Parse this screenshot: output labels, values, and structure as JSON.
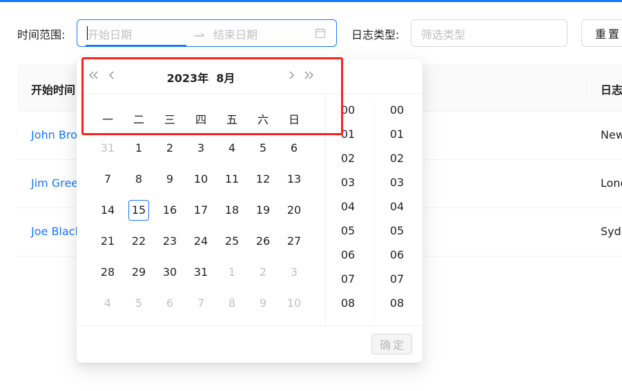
{
  "colors": {
    "primary": "#1677ff",
    "highlight": "#ff1f1f"
  },
  "filters": {
    "time_range_label": "时间范围:",
    "start_placeholder": "开始日期",
    "separator": "→",
    "end_placeholder": "结束日期",
    "log_type_label": "日志类型:",
    "log_type_placeholder": "筛选类型",
    "reset_label": "重置"
  },
  "table": {
    "columns": [
      "开始时间",
      "日志"
    ],
    "rows": [
      {
        "name": "John Bro",
        "city": "New"
      },
      {
        "name": "Jim Gree",
        "city": "Lond"
      },
      {
        "name": "Joe Black",
        "city": "Sydn"
      }
    ]
  },
  "picker": {
    "title": "2023年  8月",
    "prev_year_icon": "double-left-icon",
    "prev_month_icon": "left-icon",
    "next_month_icon": "right-icon",
    "next_year_icon": "double-right-icon",
    "weekdays": [
      "一",
      "二",
      "三",
      "四",
      "五",
      "六",
      "日"
    ],
    "weeks": [
      [
        "31",
        "1",
        "2",
        "3",
        "4",
        "5",
        "6"
      ],
      [
        "7",
        "8",
        "9",
        "10",
        "11",
        "12",
        "13"
      ],
      [
        "14",
        "15",
        "16",
        "17",
        "18",
        "19",
        "20"
      ],
      [
        "21",
        "22",
        "23",
        "24",
        "25",
        "26",
        "27"
      ],
      [
        "28",
        "29",
        "30",
        "31",
        "1",
        "2",
        "3"
      ],
      [
        "4",
        "5",
        "6",
        "7",
        "8",
        "9",
        "10"
      ]
    ],
    "today": "15",
    "hours": [
      "00",
      "01",
      "02",
      "03",
      "04",
      "05",
      "06",
      "07",
      "08"
    ],
    "minutes": [
      "00",
      "01",
      "02",
      "03",
      "04",
      "05",
      "06",
      "07",
      "08"
    ],
    "ok_label": "确定"
  }
}
